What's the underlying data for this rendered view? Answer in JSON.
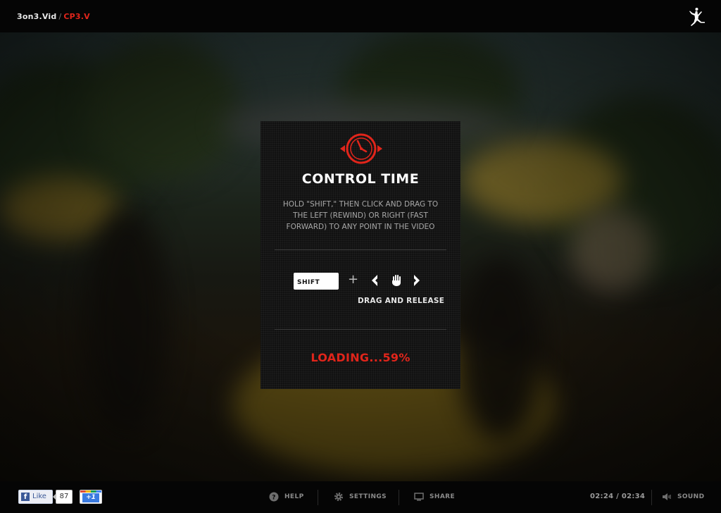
{
  "header": {
    "breadcrumb_home": "3on3.Vid",
    "breadcrumb_separator": "/",
    "breadcrumb_current": "CP3.V",
    "logo_icon": "jumpman-logo-icon"
  },
  "modal": {
    "icon": "clock-icon",
    "title": "CONTROL TIME",
    "description": "HOLD \"SHIFT,\" THEN CLICK AND DRAG TO THE LEFT (REWIND) OR RIGHT (FAST FORWARD) TO ANY POINT IN THE VIDEO",
    "shift_key_label": "SHIFT",
    "plus": "+",
    "drag_label": "DRAG AND RELEASE",
    "loading_text": "LOADING...59%",
    "loading_percent": 59
  },
  "footer": {
    "facebook": {
      "label": "Like",
      "count": "87"
    },
    "gplus_label": "+1",
    "help_label": "HELP",
    "settings_label": "SETTINGS",
    "share_label": "SHARE",
    "timecode": "02:24 / 02:34",
    "sound_label": "SOUND"
  },
  "colors": {
    "accent": "#e1251b",
    "bar_bg": "#050505",
    "modal_bg": "#111111"
  }
}
